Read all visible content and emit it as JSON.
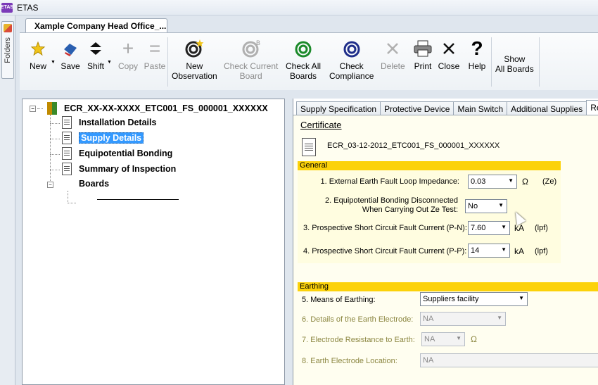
{
  "app": {
    "logo_text": "ETAS",
    "title": "ETAS"
  },
  "folders": {
    "label": "Folders"
  },
  "document_tab": {
    "title": "Xample Company Head Office_..."
  },
  "toolbar": {
    "new": "New",
    "save": "Save",
    "shift": "Shift",
    "copy": "Copy",
    "paste": "Paste",
    "new_observation_1": "New",
    "new_observation_2": "Observation",
    "check_current_1": "Check Current",
    "check_current_2": "Board",
    "check_all_1": "Check All",
    "check_all_2": "Boards",
    "check_compliance_1": "Check",
    "check_compliance_2": "Compliance",
    "delete": "Delete",
    "print": "Print",
    "close": "Close",
    "help": "Help",
    "show_all_1": "Show",
    "show_all_2": "All Boards"
  },
  "tree": {
    "root": "ECR_XX-XX-XXXX_ETC001_FS_000001_XXXXXX",
    "items": [
      "Installation Details",
      "Supply Details",
      "Equipotential Bonding",
      "Summary of Inspection",
      "Boards"
    ]
  },
  "tabs": [
    "Supply Specification",
    "Protective Device",
    "Main Switch",
    "Additional Supplies",
    "Results"
  ],
  "certificate": {
    "link": "Certificate",
    "id": "ECR_03-12-2012_ETC001_FS_000001_XXXXXX"
  },
  "general": {
    "heading": "General",
    "q1_label": "1. External Earth Fault Loop Impedance:",
    "q1_value": "0.03",
    "q1_unit": "Ω",
    "q1_suffix": "(Ze)",
    "q2_label_1": "2. Equipotential Bonding Disconnected",
    "q2_label_2": "When Carrying Out Ze Test:",
    "q2_value": "No",
    "q3_label": "3. Prospective Short Circuit Fault Current (P-N):",
    "q3_value": "7.60",
    "q3_unit": "kA",
    "q3_suffix": "(lpf)",
    "q4_label": "4. Prospective Short Circuit Fault Current (P-P):",
    "q4_value": "14",
    "q4_unit": "kA",
    "q4_suffix": "(lpf)"
  },
  "earthing": {
    "heading": "Earthing",
    "q5_label": "5. Means of Earthing:",
    "q5_value": "Suppliers facility",
    "q6_label": "6. Details of the Earth Electrode:",
    "q6_value": "NA",
    "q7_label": "7. Electrode Resistance to Earth:",
    "q7_value": "NA",
    "q7_unit": "Ω",
    "q8_label": "8. Earth Electrode Location:",
    "q8_value": "NA"
  }
}
